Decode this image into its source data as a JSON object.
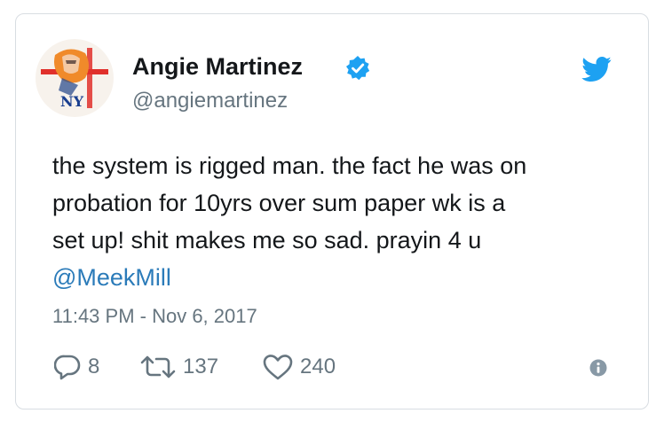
{
  "tweet": {
    "author": {
      "name": "Angie Martinez",
      "handle": "@angiemartinez",
      "verified": true,
      "avatar_icon": "profile-avatar",
      "avatar_text": "NY"
    },
    "text_lines": [
      "the system is rigged man. the fact he was on",
      "probation for 10yrs over sum paper wk is a",
      "set up! shit makes me so sad. prayin 4 u"
    ],
    "mention": "@MeekMill",
    "timestamp": "11:43 PM - Nov 6, 2017",
    "actions": {
      "replies": "8",
      "retweets": "137",
      "likes": "240"
    },
    "icons": {
      "brand": "twitter-bird-icon",
      "verified": "verified-badge-icon",
      "reply": "reply-icon",
      "retweet": "retweet-icon",
      "like": "heart-icon",
      "info": "info-icon"
    }
  },
  "colors": {
    "text": "#14171a",
    "muted": "#66757f",
    "link": "#2b7bb9",
    "brand_blue": "#1da1f2",
    "border": "#d8dde2"
  }
}
